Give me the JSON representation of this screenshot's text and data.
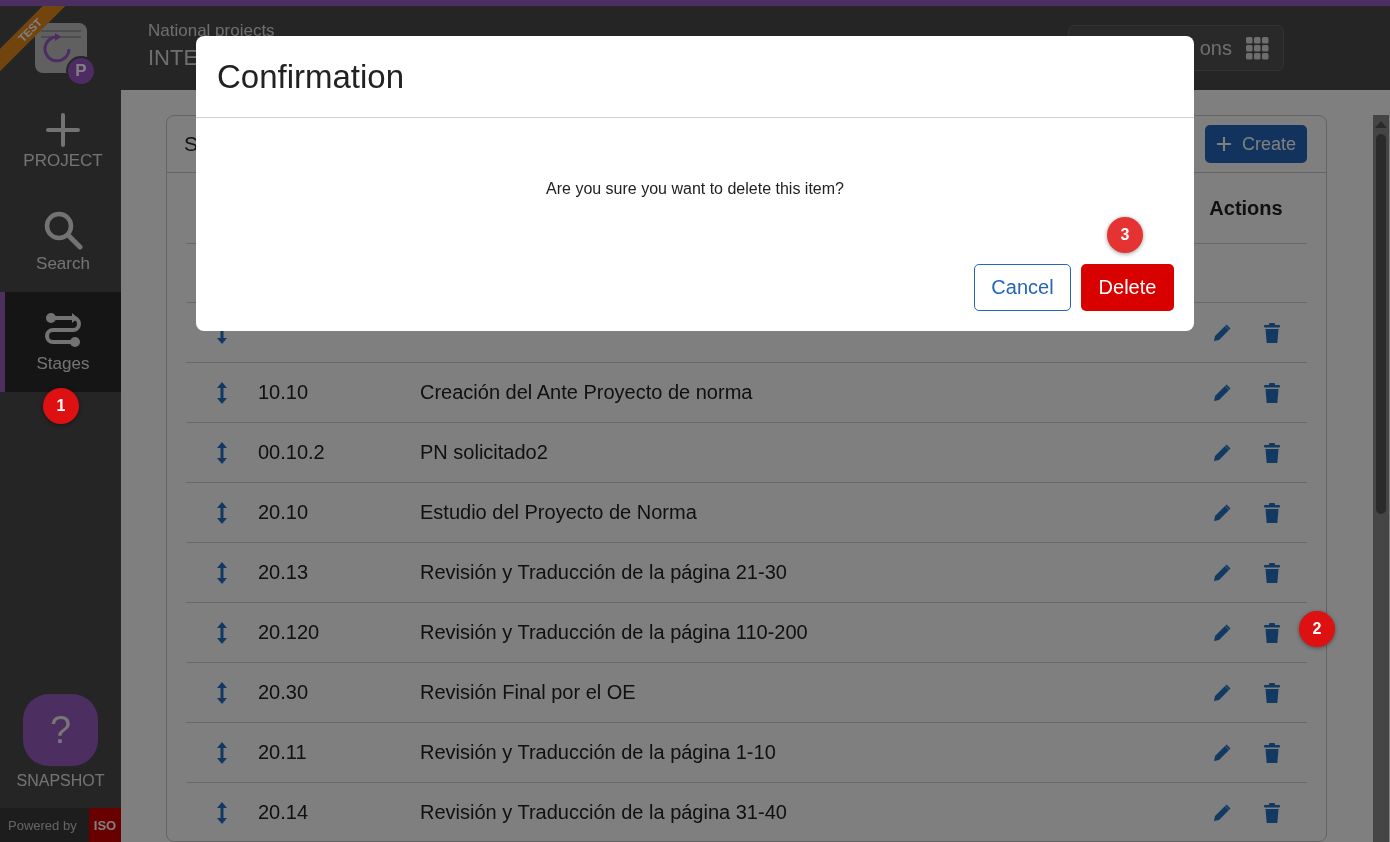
{
  "header": {
    "breadcrumb": "National projects",
    "title": "INTE",
    "apps_button": "ons"
  },
  "sidebar": {
    "ribbon": "TEST",
    "logo_badge": "P",
    "items": [
      {
        "label": "PROJECT",
        "kind": "add",
        "selected": false
      },
      {
        "label": "Search",
        "kind": "search",
        "selected": false
      },
      {
        "label": "Stages",
        "kind": "stages",
        "selected": true
      }
    ],
    "help": {
      "icon": "?",
      "label": "SNAPSHOT"
    },
    "powered_by": "Powered by",
    "powered_logo": "ISO"
  },
  "card": {
    "title": "S",
    "create_button": "Create",
    "columns": [
      "Actions"
    ],
    "rows": [
      {
        "partial": true
      },
      {
        "code": "10.10",
        "name": "Creación del Ante Proyecto de norma"
      },
      {
        "code": "00.10.2",
        "name": "PN solicitado2"
      },
      {
        "code": "20.10",
        "name": "Estudio del Proyecto de Norma"
      },
      {
        "code": "20.13",
        "name": "Revisión y Traducción de la página 21-30"
      },
      {
        "code": "20.120",
        "name": "Revisión y Traducción de la página 110-200"
      },
      {
        "code": "20.30",
        "name": "Revisión Final por el OE"
      },
      {
        "code": "20.11",
        "name": "Revisión y Traducción de la página 1-10"
      },
      {
        "code": "20.14",
        "name": "Revisión y Traducción de la página 31-40"
      }
    ]
  },
  "dialog": {
    "title": "Confirmation",
    "message": "Are you sure you want to delete this item?",
    "cancel": "Cancel",
    "confirm": "Delete"
  },
  "markers": [
    {
      "number": "1",
      "kind": "sidebar"
    },
    {
      "number": "2",
      "kind": "row"
    },
    {
      "number": "3",
      "kind": "dialog"
    }
  ]
}
